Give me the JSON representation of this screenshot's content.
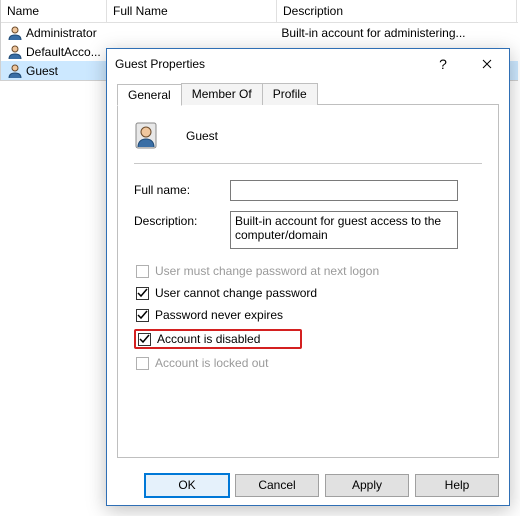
{
  "list": {
    "columns": {
      "name": "Name",
      "full": "Full Name",
      "desc": "Description"
    },
    "rows": [
      {
        "name": "Administrator",
        "full": "",
        "desc": "Built-in account for administering..."
      },
      {
        "name": "DefaultAcco...",
        "full": "",
        "desc": ""
      },
      {
        "name": "Guest",
        "full": "",
        "desc": ""
      }
    ]
  },
  "dialog": {
    "title": "Guest Properties",
    "tabs": {
      "general": "General",
      "memberof": "Member Of",
      "profile": "Profile"
    },
    "header_name": "Guest",
    "labels": {
      "fullname": "Full name:",
      "description": "Description:"
    },
    "values": {
      "fullname": "",
      "description": "Built-in account for guest access to the computer/domain"
    },
    "checks": {
      "must_change": "User must change password at next logon",
      "cannot_change": "User cannot change password",
      "never_expires": "Password never expires",
      "disabled": "Account is disabled",
      "locked": "Account is locked out"
    },
    "buttons": {
      "ok": "OK",
      "cancel": "Cancel",
      "apply": "Apply",
      "help": "Help"
    }
  }
}
